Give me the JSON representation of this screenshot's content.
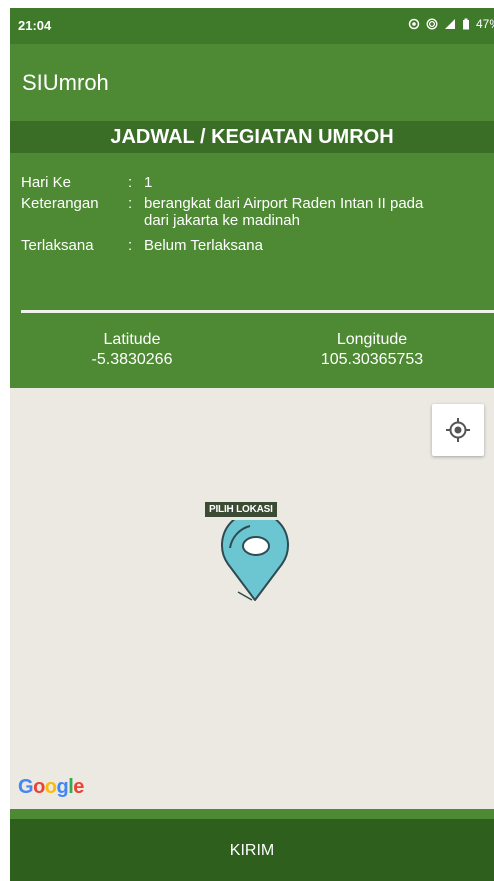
{
  "status_bar": {
    "time": "21:04",
    "battery": "47%"
  },
  "app": {
    "title": "SIUmroh"
  },
  "section": {
    "title": "JADWAL / KEGIATAN UMROH"
  },
  "info": {
    "rows": [
      {
        "label": "Hari Ke",
        "colon": ":",
        "value": "1"
      },
      {
        "label": "Keterangan",
        "colon": ":",
        "value_line1": "berangkat dari Airport Raden Intan II pada",
        "value_line2": "dari jakarta ke madinah"
      },
      {
        "label": "Terlaksana",
        "colon": ":",
        "value": "Belum Terlaksana"
      }
    ]
  },
  "coordinates": {
    "latitude_label": "Latitude",
    "latitude_value": "-5.3830266",
    "longitude_label": "Longitude",
    "longitude_value": "105.30365753"
  },
  "map": {
    "pin_label": "PILIH LOKASI",
    "google_logo": [
      "G",
      "o",
      "o",
      "g",
      "l",
      "e"
    ],
    "google_colors": [
      "#4285F4",
      "#EA4335",
      "#FBBC05",
      "#4285F4",
      "#34A853",
      "#EA4335"
    ],
    "pin_color": "#6cc6d2"
  },
  "submit": {
    "label": "KIRIM"
  },
  "colors": {
    "primary": "#4e8a34",
    "primary_dark": "#3a6d26",
    "button": "#2e5f1c",
    "map_bg": "#ebe9e2"
  }
}
